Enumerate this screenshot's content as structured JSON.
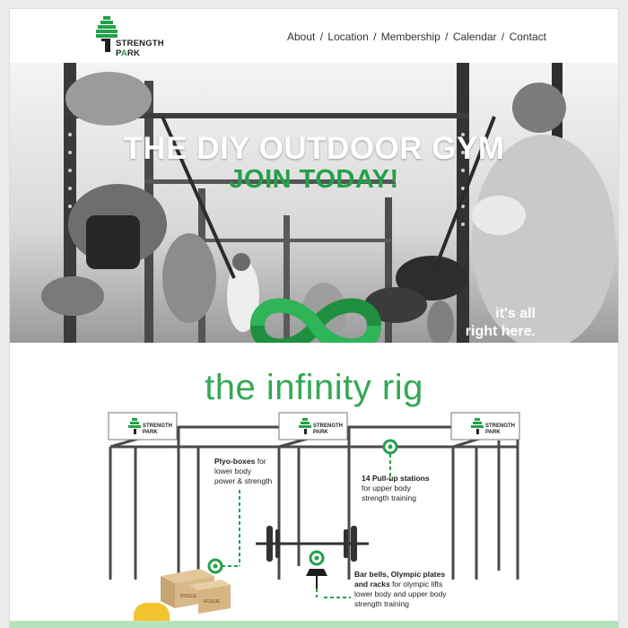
{
  "brand": {
    "line1": "STRENGTH",
    "line2_prefix": "P",
    "line2_accent": "A",
    "line2_suffix": "RK",
    "green": "#23a14a",
    "logo_icon": "tree-logo-icon"
  },
  "nav": {
    "items": [
      "About",
      "Location",
      "Membership",
      "Calendar",
      "Contact"
    ],
    "separator": "/"
  },
  "hero": {
    "title": "THE DIY OUTDOOR GYM",
    "cta": "JOIN TODAY!",
    "tagline_line1": "it's all",
    "tagline_line2": "right here.",
    "emblem": "infinity-icon"
  },
  "rig": {
    "title": "the infinity rig",
    "sign_brand_line1": "STRENGTH",
    "sign_brand_line2": "PARK",
    "callouts": {
      "plyo_bold": "Plyo-boxes",
      "plyo_rest_1": " for",
      "plyo_line2": "lower body",
      "plyo_line3": "power & strength",
      "pullup_bold": "14 Pull-up stations",
      "pullup_line2": "for upper body",
      "pullup_line3": "strength training",
      "barbell_bold_1": "Bar bells, Olympic plates",
      "barbell_bold_2": "and racks",
      "barbell_rest": " for olympic lifts",
      "barbell_line3": "lower body and upper body",
      "barbell_line4": "strength training"
    },
    "box_label": "ROGUE"
  }
}
